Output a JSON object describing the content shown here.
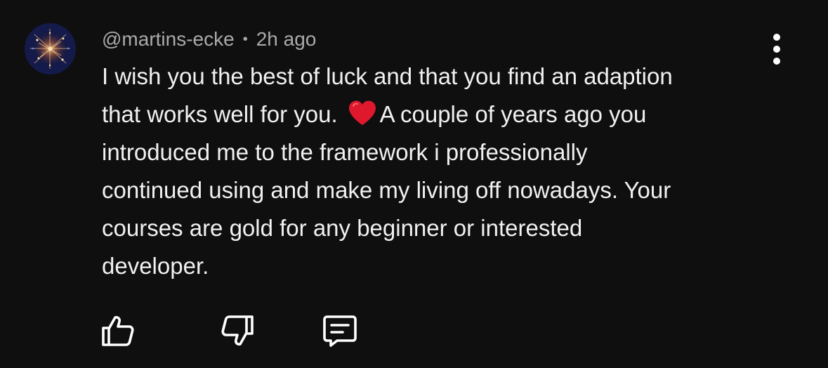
{
  "comment": {
    "author": "@martins-ecke",
    "separator": "•",
    "timestamp": "2h ago",
    "text_lines": [
      "I wish you the best of luck and that you find an adaption",
      "that works well for you.",
      "A couple of years ago you",
      "introduced me to the framework i professionally",
      "continued using and make my living off nowadays. Your",
      "courses are gold for any beginner or interested",
      "developer."
    ],
    "emoji": "red-heart-icon"
  },
  "actions": {
    "like_icon": "thumbs-up-icon",
    "dislike_icon": "thumbs-down-icon",
    "reply_icon": "reply-comment-icon"
  },
  "menu_icon": "more-vertical-icon",
  "colors": {
    "background": "#0f0f0f",
    "text": "#f1f1f1",
    "meta": "#aaaaaa",
    "heart": "#e0182d"
  }
}
